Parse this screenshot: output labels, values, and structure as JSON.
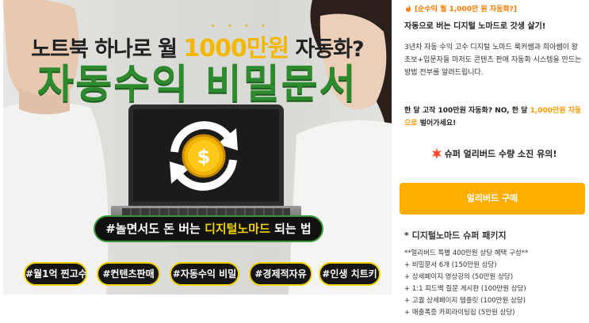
{
  "banner": {
    "headline_prefix": "노트북 하나로 월 ",
    "headline_highlight": "1000만원",
    "headline_suffix": " 자동화?",
    "title": "자동수익 비밀문서",
    "slogan_prefix": "#놀면서도 돈 버는 ",
    "slogan_highlight": "디지털노마드",
    "slogan_suffix": " 되는 법",
    "coin_symbol": "$",
    "tags": [
      "#월1억 찐고수",
      "#컨텐츠판매",
      "#자동수익 비밀",
      "#경제적자유",
      "#인생 치트키"
    ]
  },
  "product": {
    "badge": "[순수익 월 1,000만 원 자동화?]",
    "subtitle": "자동으로 버는 디지털 노마드로 갓생 살기!",
    "description": "3년차 자동 수익 고수 디지털 노마드 룩커쌤과 희아쌤이 왕초보+입문자들 마저도 콘텐츠 판매 자동화 시스템을 만드는 방법 전부를 알려드립니다.",
    "tagline_prefix": "한 달 고작 100만원 자동화? NO, 한 달 ",
    "tagline_highlight": "1,000만원 자동으로",
    "tagline_suffix": " 벌어가세요!",
    "warning": "슈퍼 얼리버드 수량 소진 유의!",
    "buy_label": "얼리버드 구매",
    "package_title": "* 디지털노마드 슈퍼 패키지",
    "package_items": [
      "**얼리버드 특별 400만원 상당 혜택 구성**",
      "+ 비밀문서 6개 (150만원 상당)",
      "+ 상세페이지 영상강의 (50만원 상당)",
      "+ 1:1 피드백 질문 게시판 (100만원 상당)",
      "+ 고퀄 상세페이지 템플릿 (100만원 상당)",
      "+ 매출폭증 카피라이팅집 (5만원 상당)"
    ]
  },
  "colors": {
    "accent_orange": "#ffae00",
    "highlight_yellow": "#f2d200",
    "title_green": "#2e8a2e",
    "badge_orange": "#ff7a00"
  },
  "icons": {
    "badge_icon": "fire-icon",
    "warning_icon": "burst-icon",
    "coin_icon": "dollar-coin-icon",
    "cycle_icon": "refresh-arrows-icon"
  }
}
